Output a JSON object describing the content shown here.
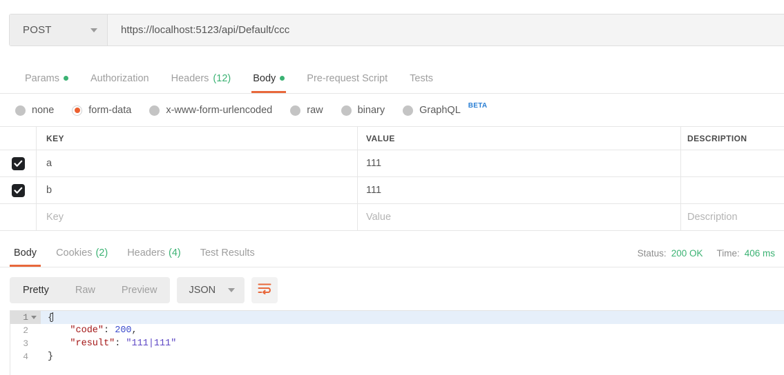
{
  "request": {
    "method": "POST",
    "url": "https://localhost:5123/api/Default/ccc",
    "tabs": [
      {
        "label": "Params",
        "dot": true,
        "count": "",
        "active": false
      },
      {
        "label": "Authorization",
        "dot": false,
        "count": "",
        "active": false
      },
      {
        "label": "Headers",
        "dot": false,
        "count": "(12)",
        "active": false
      },
      {
        "label": "Body",
        "dot": true,
        "count": "",
        "active": true
      },
      {
        "label": "Pre-request Script",
        "dot": false,
        "count": "",
        "active": false
      },
      {
        "label": "Tests",
        "dot": false,
        "count": "",
        "active": false
      }
    ],
    "body_types": [
      {
        "label": "none",
        "selected": false,
        "beta": ""
      },
      {
        "label": "form-data",
        "selected": true,
        "beta": ""
      },
      {
        "label": "x-www-form-urlencoded",
        "selected": false,
        "beta": ""
      },
      {
        "label": "raw",
        "selected": false,
        "beta": ""
      },
      {
        "label": "binary",
        "selected": false,
        "beta": ""
      },
      {
        "label": "GraphQL",
        "selected": false,
        "beta": "BETA"
      }
    ],
    "table": {
      "columns": [
        "KEY",
        "VALUE",
        "DESCRIPTION"
      ],
      "rows": [
        {
          "checked": true,
          "key": "a",
          "value": "111",
          "description": "",
          "placeholder": false
        },
        {
          "checked": true,
          "key": "b",
          "value": "111",
          "description": "",
          "placeholder": false
        },
        {
          "checked": false,
          "key": "Key",
          "value": "Value",
          "description": "Description",
          "placeholder": true
        }
      ]
    }
  },
  "response": {
    "tabs": [
      {
        "label": "Body",
        "count": "",
        "active": true
      },
      {
        "label": "Cookies",
        "count": "(2)",
        "active": false
      },
      {
        "label": "Headers",
        "count": "(4)",
        "active": false
      },
      {
        "label": "Test Results",
        "count": "",
        "active": false
      }
    ],
    "status_label": "Status:",
    "status_value": "200 OK",
    "time_label": "Time:",
    "time_value": "406 ms",
    "view_modes": [
      {
        "label": "Pretty",
        "active": true
      },
      {
        "label": "Raw",
        "active": false
      },
      {
        "label": "Preview",
        "active": false
      }
    ],
    "format": "JSON",
    "wrap_icon": "word-wrap-icon",
    "body_lines": [
      {
        "num": "1",
        "fold": true,
        "active": true,
        "tokens": [
          {
            "t": "{",
            "c": "tok-punc"
          }
        ]
      },
      {
        "num": "2",
        "fold": false,
        "active": false,
        "tokens": [
          {
            "t": "    \"code\"",
            "c": "tok-key"
          },
          {
            "t": ": ",
            "c": "tok-punc"
          },
          {
            "t": "200",
            "c": "tok-num"
          },
          {
            "t": ",",
            "c": "tok-punc"
          }
        ]
      },
      {
        "num": "3",
        "fold": false,
        "active": false,
        "tokens": [
          {
            "t": "    \"result\"",
            "c": "tok-key"
          },
          {
            "t": ": ",
            "c": "tok-punc"
          },
          {
            "t": "\"111|111\"",
            "c": "tok-str"
          }
        ]
      },
      {
        "num": "4",
        "fold": false,
        "active": false,
        "tokens": [
          {
            "t": "}",
            "c": "tok-punc"
          }
        ]
      }
    ]
  },
  "colors": {
    "accent": "#e8683b",
    "success": "#3bb273",
    "beta": "#2a7fd4",
    "checkbox": "#1f2124"
  }
}
